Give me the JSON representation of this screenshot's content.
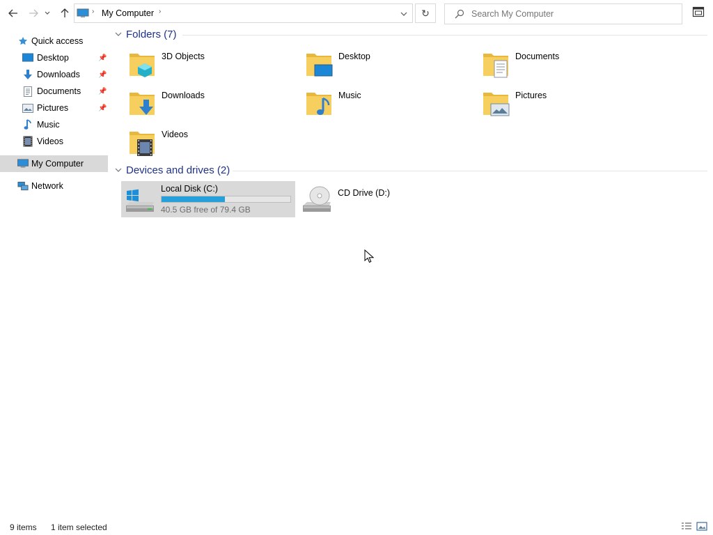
{
  "address": {
    "location": "My Computer"
  },
  "search": {
    "placeholder": "Search My Computer"
  },
  "sidebar": {
    "quick_access": "Quick access",
    "items": [
      {
        "label": "Desktop"
      },
      {
        "label": "Downloads"
      },
      {
        "label": "Documents"
      },
      {
        "label": "Pictures"
      },
      {
        "label": "Music"
      },
      {
        "label": "Videos"
      }
    ],
    "my_computer": "My Computer",
    "network": "Network"
  },
  "groups": {
    "folders": "Folders (7)",
    "devices": "Devices and drives (2)"
  },
  "folders": [
    {
      "name": "3D Objects"
    },
    {
      "name": "Desktop"
    },
    {
      "name": "Documents"
    },
    {
      "name": "Downloads"
    },
    {
      "name": "Music"
    },
    {
      "name": "Pictures"
    },
    {
      "name": "Videos"
    }
  ],
  "drives": [
    {
      "name": "Local Disk (C:)",
      "free": "40.5 GB free of 79.4 GB",
      "used_fraction": 0.49
    },
    {
      "name": "CD Drive (D:)"
    }
  ],
  "status": {
    "items": "9 items",
    "selected": "1 item selected"
  },
  "colors": {
    "accent": "#1e3287",
    "selection": "#d9d9d9",
    "progress": "#26a0da",
    "folder": "#f6cf5f"
  }
}
